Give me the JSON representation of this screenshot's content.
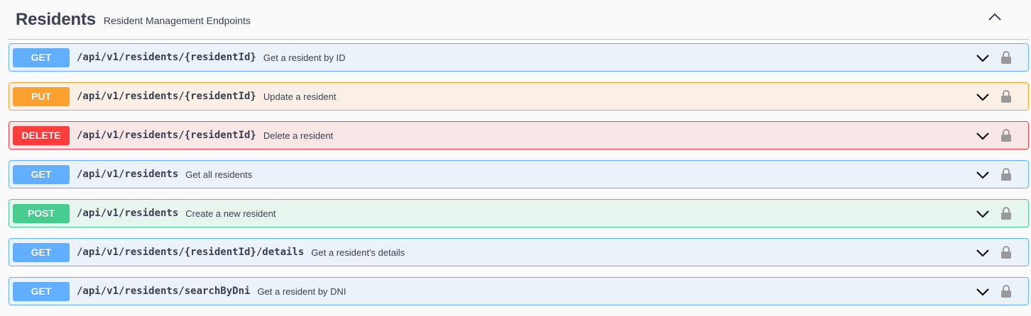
{
  "tag": {
    "name": "Residents",
    "description": "Resident Management Endpoints"
  },
  "operations": [
    {
      "method": "GET",
      "path": "/api/v1/residents/{residentId}",
      "summary": "Get a resident by ID"
    },
    {
      "method": "PUT",
      "path": "/api/v1/residents/{residentId}",
      "summary": "Update a resident"
    },
    {
      "method": "DELETE",
      "path": "/api/v1/residents/{residentId}",
      "summary": "Delete a resident"
    },
    {
      "method": "GET",
      "path": "/api/v1/residents",
      "summary": "Get all residents"
    },
    {
      "method": "POST",
      "path": "/api/v1/residents",
      "summary": "Create a new resident"
    },
    {
      "method": "GET",
      "path": "/api/v1/residents/{residentId}/details",
      "summary": "Get a resident's details"
    },
    {
      "method": "GET",
      "path": "/api/v1/residents/searchByDni",
      "summary": "Get a resident by DNI"
    }
  ],
  "icons": {
    "collapse": "chevron-up-icon",
    "expand": "chevron-down-icon",
    "auth": "lock-icon"
  },
  "colors": {
    "get": "#61affe",
    "put": "#fca130",
    "delete": "#f93e3e",
    "post": "#49cc90",
    "text": "#3b4151"
  }
}
